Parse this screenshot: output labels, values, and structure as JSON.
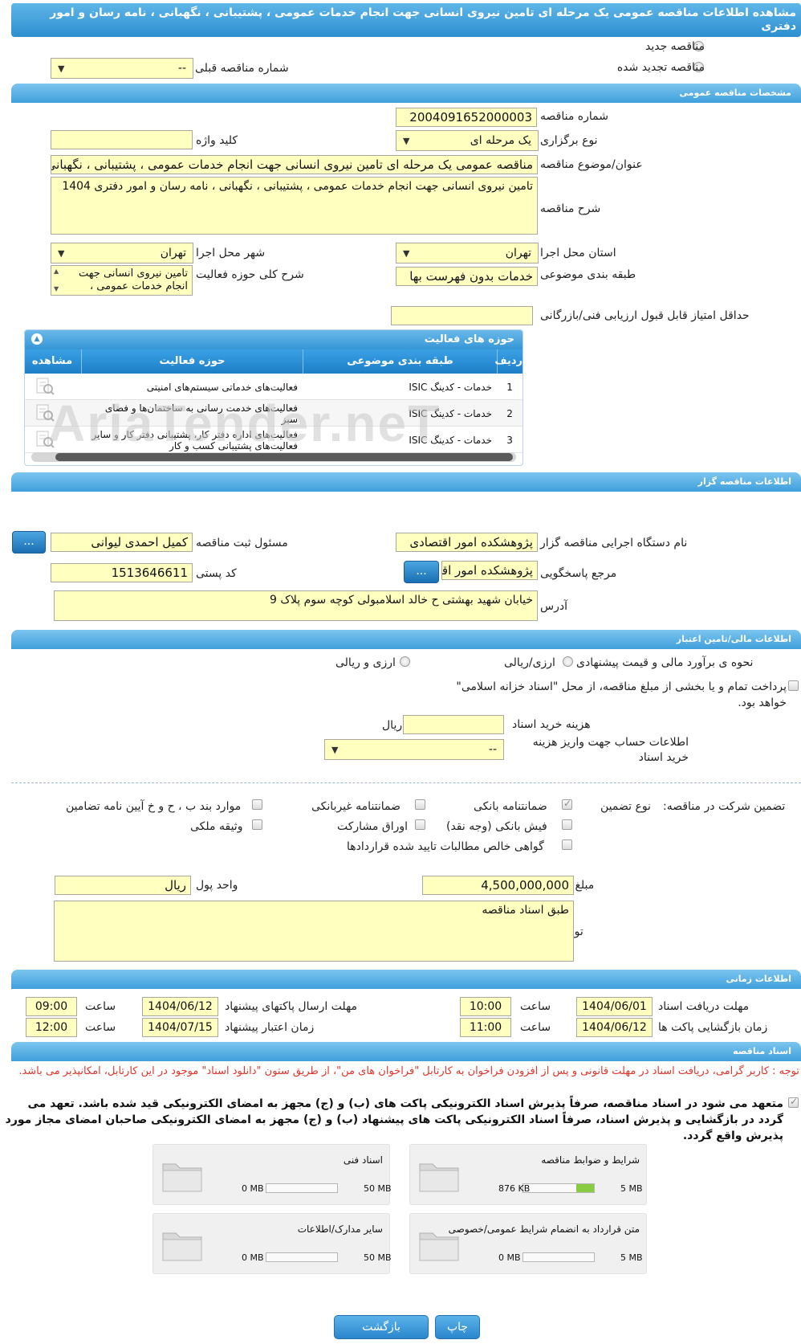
{
  "header": {
    "title": "مشاهده اطلاعات مناقصه عمومی یک مرحله ای تامین نیروی انسانی جهت انجام خدمات عمومی ، پشتیبانی ، نگهبانی ، نامه رسان و امور دفتری"
  },
  "top": {
    "radio_new": "مناقصه جدید",
    "radio_renewed": "مناقصه تجدید شده",
    "prev_number_label": "شماره مناقصه قبلی",
    "prev_number_value": "--"
  },
  "sections": {
    "general": "مشخصات مناقصه عمومی",
    "organizer": "اطلاعات مناقصه گزار",
    "financial": "اطلاعات مالی/تامین اعتبار",
    "timing": "اطلاعات زمانی",
    "documents": "اسناد مناقصه"
  },
  "general": {
    "number_label": "شماره مناقصه",
    "number_value": "2004091652000003",
    "type_label": "نوع برگزاری",
    "type_value": "یک مرحله ای",
    "keyword_label": "کلید واژه",
    "keyword_value": "",
    "subject_label": "عنوان/موضوع مناقصه",
    "subject_value": "مناقصه عمومی یک مرحله ای تامین  نیروی انسانی جهت انجام خدمات عمومی ، پشتیبانی ، نگهبانی ،",
    "desc_label": "شرح مناقصه",
    "desc_value": "تامین  نیروی انسانی جهت انجام خدمات عمومی ، پشتیبانی ، نگهبانی ، نامه رسان و امور دفتری 1404",
    "province_label": "استان محل اجرا",
    "province_value": "تهران",
    "city_label": "شهر محل اجرا",
    "city_value": "تهران",
    "category_label": "طبقه بندی موضوعی",
    "category_value": "خدمات بدون فهرست بها",
    "activity_desc_label": "شرح کلی حوزه فعالیت",
    "activity_desc_value": "تامین نیروی انسانی جهت انجام خدمات عمومی ،",
    "min_score_label": "حداقل امتیاز قابل قبول ارزیابی فنی/بازرگانی",
    "min_score_value": ""
  },
  "activity_grid": {
    "title": "حوزه های فعالیت",
    "headers": [
      "ردیف",
      "طبقه بندی موضوعی",
      "حوزه فعالیت",
      "مشاهده"
    ],
    "rows": [
      {
        "idx": "1",
        "category": "خدمات - کدینگ ISIC",
        "activity": "فعالیت‌های خدماتی سیستم‌های امنیتی"
      },
      {
        "idx": "2",
        "category": "خدمات - کدینگ ISIC",
        "activity": "فعالیت‌های خدمت رسانی به ساختمان‌ها و فضای سبز"
      },
      {
        "idx": "3",
        "category": "خدمات - کدینگ ISIC",
        "activity": "فعالیت‌های  اداره دفتر کار، پشتیبانی دفتر کار و سایر  فعالیت‌های پشتیبانی کسب و کار"
      }
    ]
  },
  "organizer": {
    "agency_label": "نام دستگاه اجرایی مناقصه گزار",
    "agency_value": "پژوهشکده امور اقتصادی",
    "registrar_label": "مسئول ثبت مناقصه",
    "registrar_value": "کمیل احمدی لیوانی",
    "reference_label": "مرجع پاسخگویی",
    "reference_value": "پژوهشکده امور اقتصادی",
    "postal_label": "کد پستی",
    "postal_value": "1513646611",
    "address_label": "آدرس",
    "address_value": "خیابان شهید بهشتی ح  خالد اسلامبولی کوچه سوم پلاک 9",
    "dots": "..."
  },
  "financial": {
    "estimate_label": "نحوه ی برآورد مالی و قیمت پیشنهادی",
    "opt_rial": "ارزی/ریالی",
    "opt_both": "ارزی و ریالی",
    "treasury_text": "پرداخت تمام و یا بخشی از مبلغ مناقصه، از محل \"اسناد خزانه اسلامی\" خواهد بود.",
    "doc_fee_label": "هزینه خرید اسناد",
    "doc_fee_value": "",
    "doc_fee_unit": "ریال",
    "account_label": "اطلاعات حساب جهت واریز هزینه خرید اسناد",
    "account_value": "--",
    "guarantee_label": "تضمین شرکت در مناقصه:",
    "guarantee_type_label": "نوع تضمین",
    "g_bank": "ضمانتنامه بانکی",
    "g_nonbank": "ضمانتنامه غیربانکی",
    "g_items": "موارد بند ب ، ح و خ آیین نامه تضامین",
    "g_cash": "فیش بانکی (وجه نقد)",
    "g_bonds": "اوراق مشارکت",
    "g_property": "وثیقه ملکی",
    "g_claims": "گواهی خالص مطالبات تایید شده قراردادها",
    "amount_label": "مبلغ تضمین",
    "amount_value": "4,500,000,000",
    "currency_label": "واحد پول",
    "currency_value": "ریال",
    "notes_label": "توضیحات",
    "notes_value": "طبق اسناد مناقصه"
  },
  "timing": {
    "receive_label": "مهلت دریافت اسناد",
    "receive_date": "1404/06/01",
    "receive_time": "10:00",
    "send_label": "مهلت ارسال پاکتهای پیشنهاد",
    "send_date": "1404/06/12",
    "send_time": "09:00",
    "open_label": "زمان بازگشایی پاکت ها",
    "open_date": "1404/06/12",
    "open_time": "11:00",
    "validity_label": "زمان اعتبار پیشنهاد",
    "validity_date": "1404/07/15",
    "validity_time": "12:00",
    "time_label": "ساعت"
  },
  "documents": {
    "note": "توجه : کاربر گرامی، دریافت اسناد در مهلت قانونی و پس از افزودن فراخوان به کارتابل \"فراخوان های من\"، از طریق ستون \"دانلود اسناد\" موجود در این کارتابل، امکانپذیر می باشد.",
    "commitment": "متعهد می شود در اسناد مناقصه، صرفاً پذیرش اسناد الکترونیکی پاکت های (ب) و (ج) مجهز به امضای الکترونیکی قید شده باشد. تعهد می گردد در بازگشایی و پذیرش اسناد، صرفاً اسناد الکترونیکی پاکت های پیشنهاد (ب) و (ج) مجهز به امضای الکترونیکی صاحبان امضای مجاز مورد پذیرش واقع گردد.",
    "cards": [
      {
        "name": "شرایط و ضوابط مناقصه",
        "used": "876 KB",
        "max": "5 MB",
        "fill": 0.25
      },
      {
        "name": "اسناد فنی",
        "used": "0 MB",
        "max": "50 MB",
        "fill": 0
      },
      {
        "name": "متن قرارداد به انضمام شرایط عمومی/خصوصی",
        "used": "0 MB",
        "max": "5 MB",
        "fill": 0
      },
      {
        "name": "سایر مدارک/اطلاعات",
        "used": "0 MB",
        "max": "50 MB",
        "fill": 0
      }
    ]
  },
  "buttons": {
    "print": "چاپ",
    "back": "بازگشت"
  },
  "watermark": "AriaTender.neT"
}
